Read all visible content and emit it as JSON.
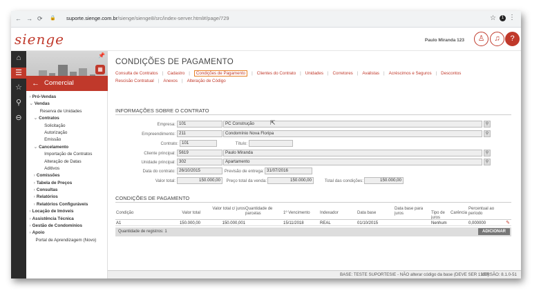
{
  "browser": {
    "url_host": "suporte.sienge.com.br",
    "url_path": "/sienge/sienge8/src/index-server.html#/page/729"
  },
  "header": {
    "logo": "sienge",
    "user_name": "Paulo Miranda 123"
  },
  "sidebar": {
    "module_title": "Comercial",
    "items": [
      {
        "label": "Pró-Vendas",
        "bold": true,
        "prefix": "›"
      },
      {
        "label": "Vendas",
        "bold": true,
        "prefix": "⌄"
      },
      {
        "label": "Reserva de Unidades",
        "bold": false,
        "prefix": ""
      },
      {
        "label": "Contratos",
        "bold": true,
        "prefix": "⌄"
      },
      {
        "label": "Solicitação",
        "bold": false,
        "prefix": ""
      },
      {
        "label": "Autorização",
        "bold": false,
        "prefix": ""
      },
      {
        "label": "Emissão",
        "bold": false,
        "prefix": ""
      },
      {
        "label": "Cancelamento",
        "bold": true,
        "prefix": "⌄"
      },
      {
        "label": "Importação de Contratos",
        "bold": false,
        "prefix": ""
      },
      {
        "label": "Alteração de Datas",
        "bold": false,
        "prefix": ""
      },
      {
        "label": "Aditivos",
        "bold": false,
        "prefix": ""
      },
      {
        "label": "Comissões",
        "bold": true,
        "prefix": "›"
      },
      {
        "label": "Tabela de Preços",
        "bold": true,
        "prefix": "›"
      },
      {
        "label": "Consultas",
        "bold": true,
        "prefix": "›"
      },
      {
        "label": "Relatórios",
        "bold": true,
        "prefix": "›"
      },
      {
        "label": "Relatórios Configuráveis",
        "bold": true,
        "prefix": "›"
      },
      {
        "label": "Locação de Imóveis",
        "bold": true,
        "prefix": "›"
      },
      {
        "label": "Assistência Técnica",
        "bold": true,
        "prefix": "›"
      },
      {
        "label": "Gestão de Condomínios",
        "bold": true,
        "prefix": "›"
      },
      {
        "label": "Apoio",
        "bold": true,
        "prefix": "›"
      },
      {
        "label": "Portal de Aprendizagem (Novo)",
        "bold": false,
        "prefix": ""
      }
    ]
  },
  "page": {
    "title": "CONDIÇÕES DE PAGAMENTO",
    "tabs_row1": [
      "Consulta de Contratos",
      "Cadastro",
      "Condições de Pagamento",
      "Clientes do Contrato",
      "Unidades",
      "Corretores",
      "Avalistas",
      "Acréscimos e Seguros",
      "Descontos"
    ],
    "tabs_row2": [
      "Rescisão Contratual",
      "Anexos",
      "Alteração de Código"
    ],
    "active_tab": "Condições de Pagamento"
  },
  "contract": {
    "section_title": "INFORMAÇÕES SOBRE O CONTRATO",
    "empresa_label": "Empresa:",
    "empresa_code": "101",
    "empresa_name": "PC Construção",
    "empreend_label": "Empreendimento:",
    "empreend_code": "211",
    "empreend_name": "Condomínio Nova Floripa",
    "contrato_label": "Contrato:",
    "contrato_value": "101",
    "titulo_label": "Título:",
    "titulo_value": "",
    "cliente_label": "Cliente principal:",
    "cliente_code": "5619",
    "cliente_name": "Paulo Miranda",
    "unidade_label": "Unidade principal:",
    "unidade_code": "302",
    "unidade_name": "Apartamento",
    "data_label": "Data do contrato:",
    "data_value": "26/10/2015",
    "previsao_label": "Previsão de entrega:",
    "previsao_value": "31/07/2016",
    "valor_label": "Valor total:",
    "valor_value": "150.000,00",
    "preco_label": "Preço total da venda:",
    "preco_value": "150.000,00",
    "total_cond_label": "Total das condições:",
    "total_cond_value": "150.000,00"
  },
  "conditions": {
    "section_title": "CONDIÇÕES DE PAGAMENTO",
    "columns": [
      "Condição",
      "Valor total",
      "Valor total c/ juros",
      "Quantidade de parcelas",
      "1º Vencimento",
      "Indexador",
      "Data base",
      "Data base para juros",
      "Tipo de juros",
      "Carência",
      "Percentual ao período"
    ],
    "row": [
      "A1",
      "150.000,00",
      "150.000,001",
      "",
      "15/11/2018",
      "REAL",
      "01/10/2015",
      "",
      "Nenhum",
      "",
      "0,000000"
    ],
    "record_count": "Quantidade de registros: 1",
    "add_button": "ADICIONAR"
  },
  "footer": {
    "base": "BASE: TESTE SUPORTESIE - NÃO alterar código da base (DEVE SER 1228)",
    "version": "VERSÃO: 8.1.0-51"
  }
}
